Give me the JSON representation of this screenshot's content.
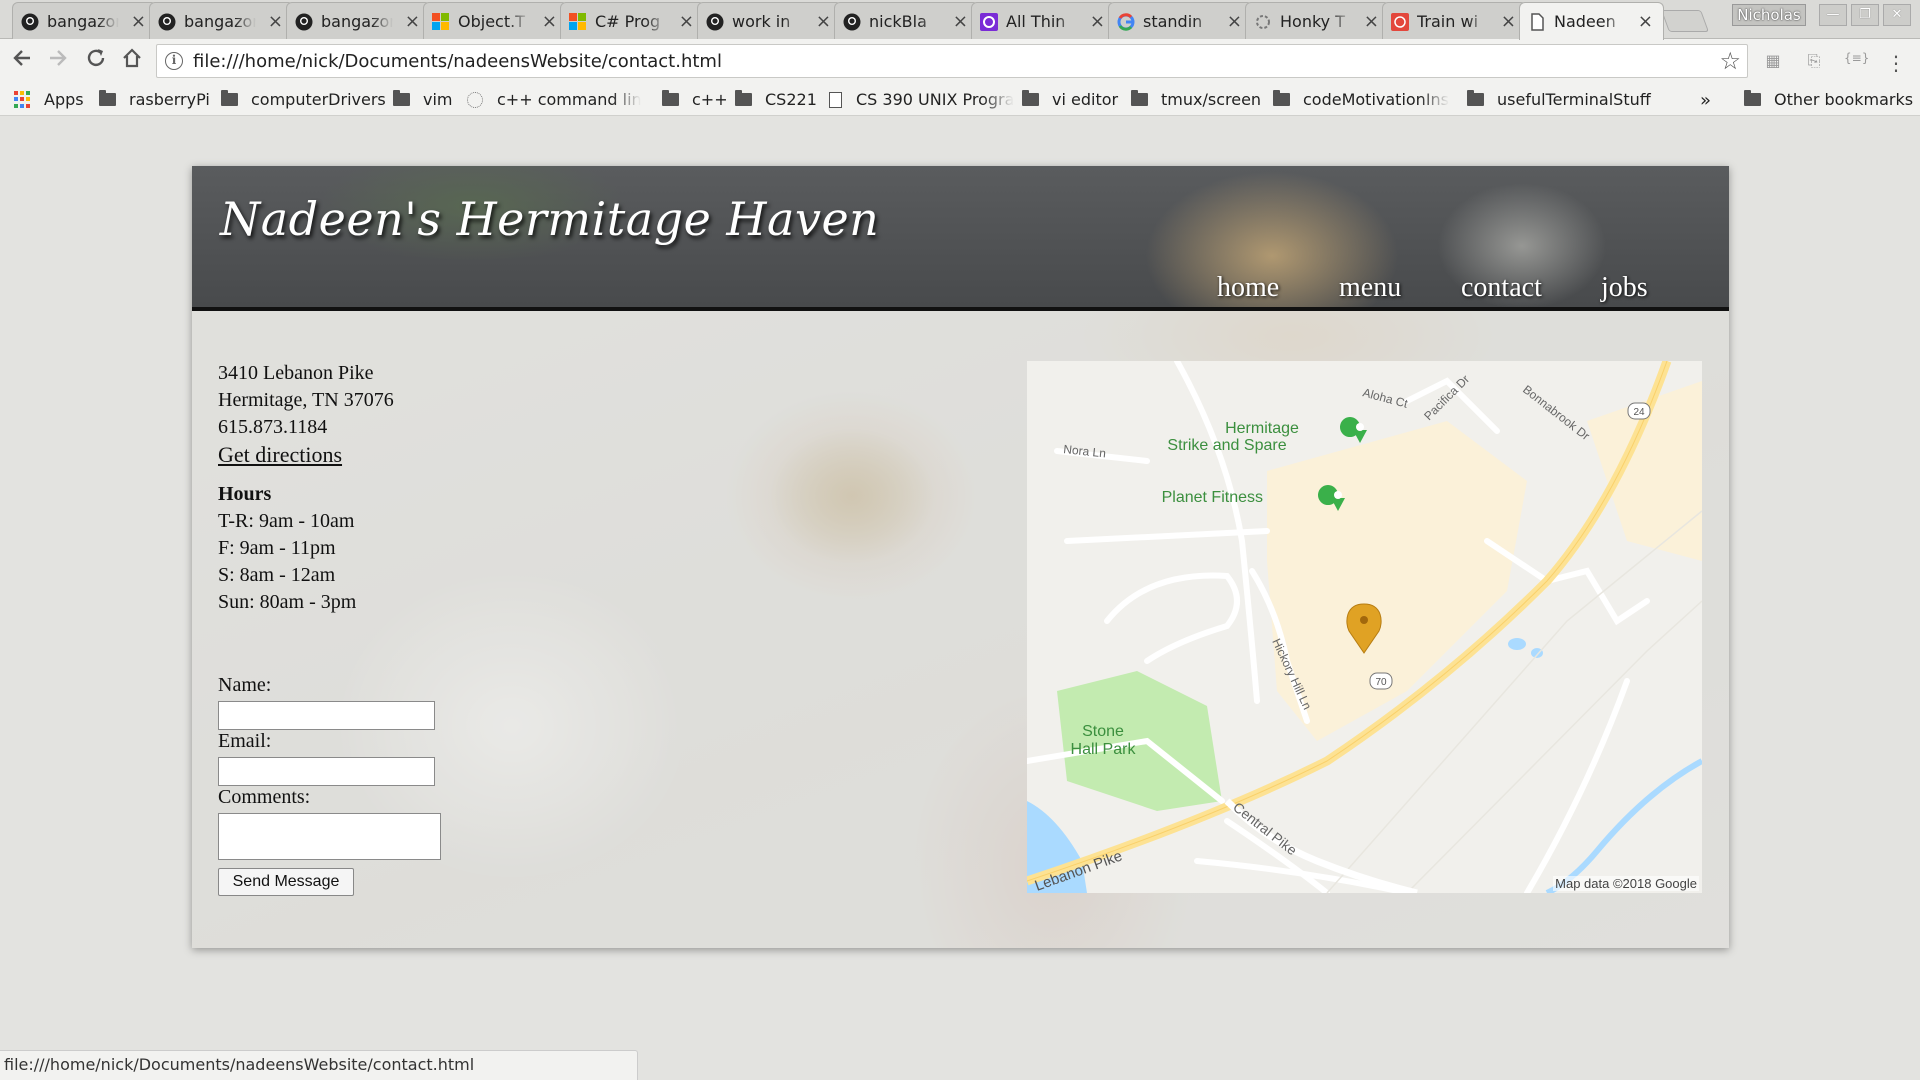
{
  "browser": {
    "tabs": [
      {
        "label": "bangazon",
        "icon": "github-icon"
      },
      {
        "label": "bangazon",
        "icon": "github-icon"
      },
      {
        "label": "bangazon",
        "icon": "github-icon"
      },
      {
        "label": "Object.T",
        "icon": "microsoft-icon"
      },
      {
        "label": "C# Prog",
        "icon": "microsoft-icon"
      },
      {
        "label": "work in",
        "icon": "github-icon"
      },
      {
        "label": "nickBla",
        "icon": "github-icon"
      },
      {
        "label": "All Thin",
        "icon": "purple-app-icon"
      },
      {
        "label": "standin",
        "icon": "google-icon"
      },
      {
        "label": "Honky T",
        "icon": "spinner-icon"
      },
      {
        "label": "Train wi",
        "icon": "red-app-icon"
      },
      {
        "label": "Nadeen",
        "icon": "page-icon"
      }
    ],
    "user": "Nicholas",
    "url": "file:///home/nick/Documents/nadeensWebsite/contact.html",
    "bookmarks": [
      "Apps",
      "rasberryPi",
      "computerDrivers",
      "vim",
      "c++ command line V",
      "c++",
      "CS221",
      "CS 390 UNIX Progra",
      "vi editor",
      "tmux/screen",
      "codeMotivationInsp",
      "usefulTerminalStuff"
    ],
    "overflow": "»",
    "other_bookmarks": "Other bookmarks",
    "status_url": "file:///home/nick/Documents/nadeensWebsite/contact.html"
  },
  "site": {
    "logo": "Nadeen's Hermitage Haven",
    "nav": [
      "home",
      "menu",
      "contact",
      "jobs"
    ],
    "address": [
      "3410 Lebanon Pike",
      "Hermitage, TN 37076",
      "615.873.1184"
    ],
    "directions": "Get directions",
    "hours_title": "Hours",
    "hours": [
      "T-R: 9am - 10am",
      "F: 9am - 11pm",
      "S: 8am - 12am",
      "Sun: 80am - 3pm"
    ],
    "form": {
      "name_label": "Name:",
      "email_label": "Email:",
      "comments_label": "Comments:",
      "send_label": "Send Message"
    },
    "map": {
      "labels": {
        "aloha": "Aloha Ct",
        "pacifica": "Pacifica Dr",
        "bonnabrook": "Bonnabrook Dr",
        "nora": "Nora Ln",
        "hickory": "Hickory Hill Ln",
        "central": "Central Pike",
        "lebanon": "Lebanon Pike",
        "route24": "24",
        "route70": "70",
        "hermitage1": "Hermitage",
        "hermitage2": "Strike and Spare",
        "fitness": "Planet Fitness",
        "park1": "Stone",
        "park2": "Hall Park"
      },
      "attribution": "Map data ©2018 Google"
    }
  }
}
